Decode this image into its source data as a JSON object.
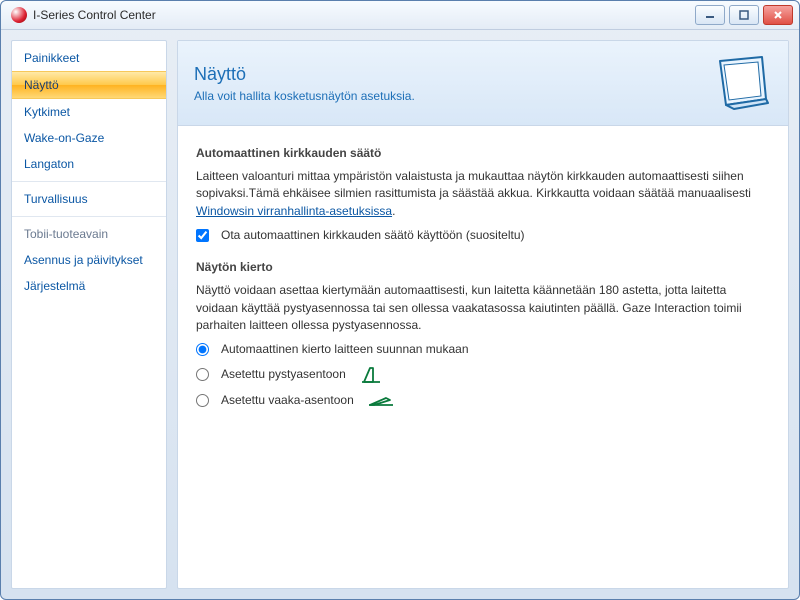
{
  "window": {
    "title": "I-Series Control Center"
  },
  "sidebar": {
    "items": [
      {
        "label": "Painikkeet"
      },
      {
        "label": "Näyttö"
      },
      {
        "label": "Kytkimet"
      },
      {
        "label": "Wake-on-Gaze"
      },
      {
        "label": "Langaton"
      },
      {
        "label": "Turvallisuus"
      },
      {
        "label": "Tobii-tuoteavain"
      },
      {
        "label": "Asennus ja päivitykset"
      },
      {
        "label": "Järjestelmä"
      }
    ]
  },
  "header": {
    "title": "Näyttö",
    "subtitle": "Alla voit hallita kosketusnäytön asetuksia."
  },
  "brightness": {
    "heading": "Automaattinen kirkkauden säätö",
    "body": "Laitteen valoanturi mittaa ympäristön valaistusta ja mukauttaa näytön kirkkauden automaattisesti siihen sopivaksi.Tämä ehkäisee silmien rasittumista ja säästää akkua. Kirkkautta voidaan säätää manuaalisesti ",
    "link": "Windowsin virranhallinta-asetuksissa",
    "period": ".",
    "checkbox_label": "Ota automaattinen kirkkauden säätö käyttöön (suositeltu)"
  },
  "rotation": {
    "heading": "Näytön kierto",
    "body": "Näyttö voidaan asettaa kiertymään automaattisesti, kun laitetta käännetään 180 astetta, jotta laitetta voidaan käyttää pystyasennossa tai sen ollessa vaakatasossa kaiutinten päällä. Gaze Interaction toimii parhaiten laitteen ollessa pystyasennossa.",
    "options": [
      {
        "label": "Automaattinen kierto laitteen suunnan mukaan"
      },
      {
        "label": "Asetettu pystyasentoon"
      },
      {
        "label": "Asetettu vaaka-asentoon"
      }
    ]
  }
}
